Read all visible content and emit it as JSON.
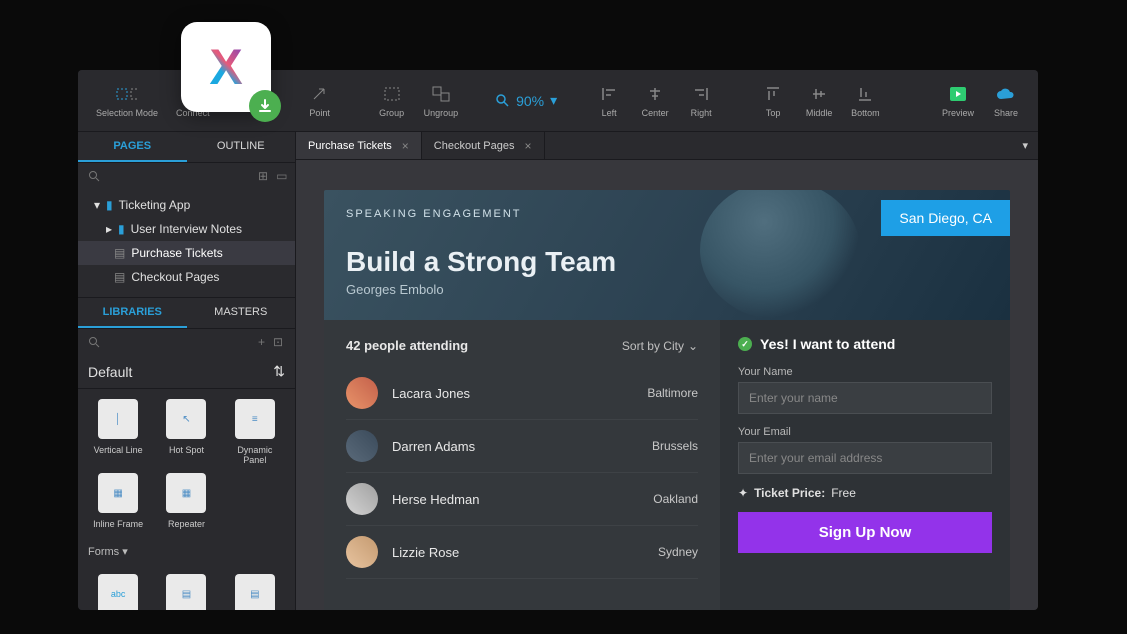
{
  "toolbar": {
    "selection_mode": "Selection Mode",
    "connect": "Connect",
    "point": "Point",
    "group": "Group",
    "ungroup": "Ungroup",
    "zoom": "90%",
    "left": "Left",
    "center": "Center",
    "right": "Right",
    "top": "Top",
    "middle": "Middle",
    "bottom": "Bottom",
    "preview": "Preview",
    "share": "Share"
  },
  "pages_panel": {
    "tabs": {
      "pages": "PAGES",
      "outline": "OUTLINE"
    },
    "tree": {
      "root": "Ticketing App",
      "notes": "User Interview Notes",
      "purchase": "Purchase Tickets",
      "checkout": "Checkout Pages"
    }
  },
  "libraries_panel": {
    "tabs": {
      "libraries": "LIBRARIES",
      "masters": "MASTERS"
    },
    "selected": "Default",
    "widgets": {
      "vline": "Vertical Line",
      "hotspot": "Hot Spot",
      "dpanel": "Dynamic Panel",
      "iframe": "Inline Frame",
      "repeater": "Repeater"
    },
    "forms_header": "Forms ▾"
  },
  "canvas_tabs": {
    "t1": "Purchase Tickets",
    "t2": "Checkout Pages"
  },
  "hero": {
    "tag": "SPEAKING ENGAGEMENT",
    "title": "Build a Strong Team",
    "author": "Georges Embolo",
    "city": "San Diego, CA"
  },
  "attend": {
    "count_label": "42 people attending",
    "sort": "Sort by City",
    "rows": [
      {
        "name": "Lacara Jones",
        "city": "Baltimore"
      },
      {
        "name": "Darren Adams",
        "city": "Brussels"
      },
      {
        "name": "Herse Hedman",
        "city": "Oakland"
      },
      {
        "name": "Lizzie Rose",
        "city": "Sydney"
      }
    ]
  },
  "form": {
    "heading": "Yes! I want to attend",
    "name_label": "Your Name",
    "name_ph": "Enter your name",
    "email_label": "Your Email",
    "email_ph": "Enter your email address",
    "price_label": "Ticket Price:",
    "price_value": "Free",
    "submit": "Sign Up Now"
  }
}
